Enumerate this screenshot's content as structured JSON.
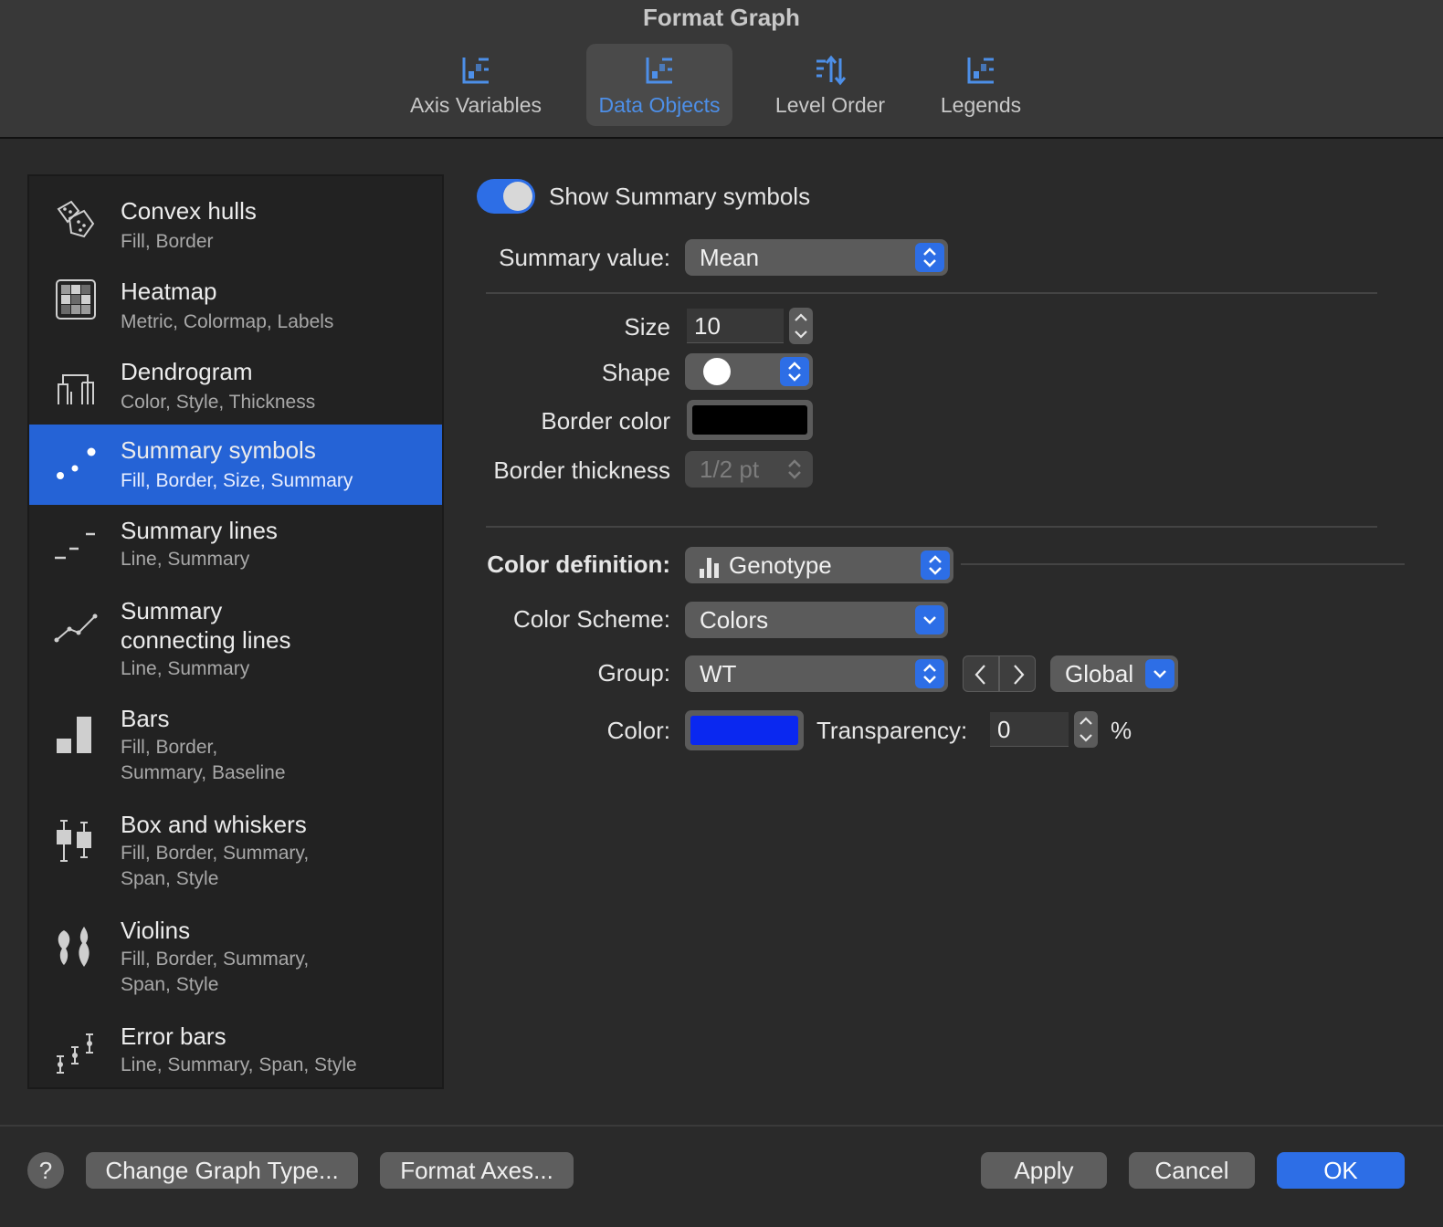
{
  "window": {
    "title": "Format Graph"
  },
  "tabs": [
    {
      "label": "Axis Variables",
      "icon": "axis-variables-icon",
      "active": false
    },
    {
      "label": "Data Objects",
      "icon": "data-objects-icon",
      "active": true
    },
    {
      "label": "Level Order",
      "icon": "level-order-icon",
      "active": false
    },
    {
      "label": "Legends",
      "icon": "legends-icon",
      "active": false
    }
  ],
  "sidebar": {
    "items": [
      {
        "title": "Convex hulls",
        "subtitle": "Fill, Border",
        "icon": "convex-hulls-icon"
      },
      {
        "title": "Heatmap",
        "subtitle": "Metric, Colormap, Labels",
        "icon": "heatmap-icon"
      },
      {
        "title": "Dendrogram",
        "subtitle": "Color, Style, Thickness",
        "icon": "dendrogram-icon"
      },
      {
        "title": "Summary symbols",
        "subtitle": "Fill, Border, Size, Summary",
        "icon": "summary-symbols-icon",
        "selected": true
      },
      {
        "title": "Summary lines",
        "subtitle": "Line, Summary",
        "icon": "summary-lines-icon"
      },
      {
        "title": "Summary",
        "title2": "connecting lines",
        "subtitle": "Line, Summary",
        "icon": "summary-connecting-lines-icon"
      },
      {
        "title": "Bars",
        "subtitle": "Fill, Border,",
        "subtitle2": "Summary, Baseline",
        "icon": "bars-icon"
      },
      {
        "title": "Box and whiskers",
        "subtitle": "Fill, Border, Summary,",
        "subtitle2": "Span, Style",
        "icon": "box-whiskers-icon"
      },
      {
        "title": "Violins",
        "subtitle": "Fill, Border, Summary,",
        "subtitle2": "Span, Style",
        "icon": "violins-icon"
      },
      {
        "title": "Error bars",
        "subtitle": "Line, Summary, Span, Style",
        "icon": "error-bars-icon"
      }
    ]
  },
  "form": {
    "show_toggle_label": "Show Summary symbols",
    "show_toggle_on": true,
    "summary_value_label": "Summary value:",
    "summary_value": "Mean",
    "size_label": "Size",
    "size_value": "10",
    "shape_label": "Shape",
    "border_color_label": "Border color",
    "border_color": "#000000",
    "border_thickness_label": "Border thickness",
    "border_thickness_value": "1/2 pt",
    "color_definition_label": "Color definition:",
    "color_definition_value": "Genotype",
    "color_scheme_label": "Color Scheme:",
    "color_scheme_value": "Colors",
    "group_label": "Group:",
    "group_value": "WT",
    "scope_value": "Global",
    "color_label": "Color:",
    "color_value": "#0a28f0",
    "transparency_label": "Transparency:",
    "transparency_value": "0",
    "transparency_unit": "%"
  },
  "footer": {
    "help_label": "?",
    "change_graph_type": "Change Graph Type...",
    "format_axes": "Format Axes...",
    "apply": "Apply",
    "cancel": "Cancel",
    "ok": "OK"
  },
  "colors": {
    "accent": "#2d6ee6",
    "selection": "#2563d6"
  }
}
